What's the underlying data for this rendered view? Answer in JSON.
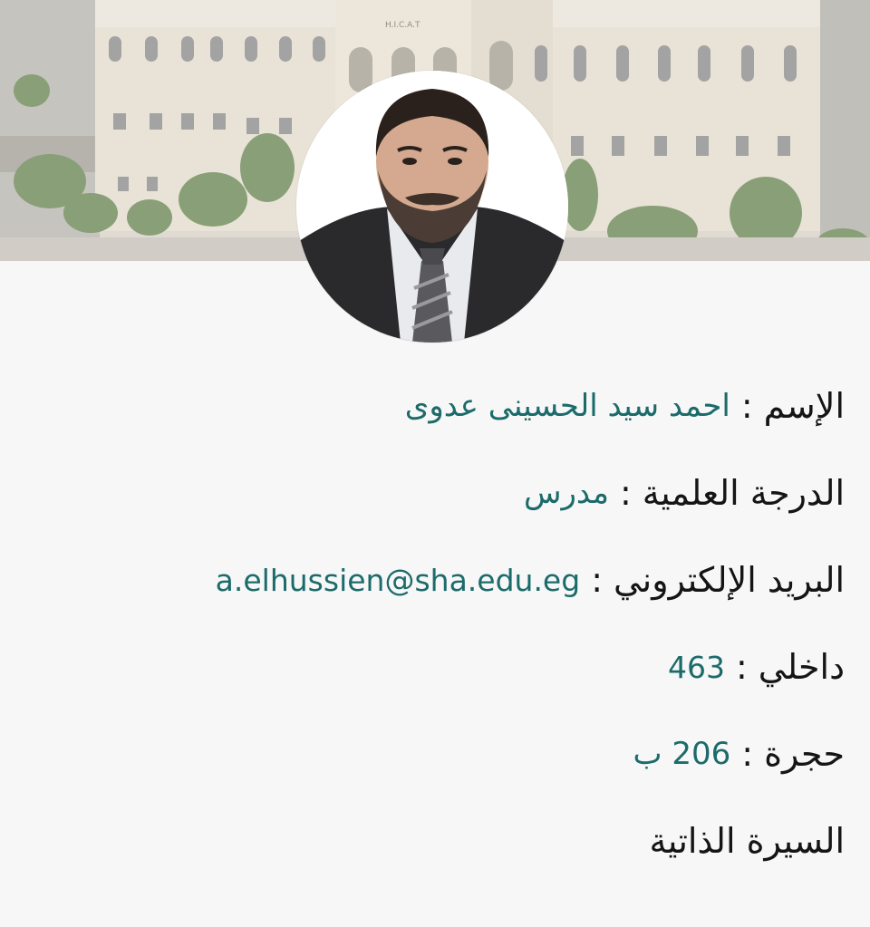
{
  "banner": {
    "building_sign": "H.I.C.A.T"
  },
  "profile": {
    "name_label": "الإسم",
    "name_value": "احمد سيد الحسينى عدوى",
    "degree_label": "الدرجة العلمية",
    "degree_value": "مدرس",
    "email_label": "البريد الإلكتروني",
    "email_value": "a.elhussien@sha.edu.eg",
    "extension_label": "داخلي",
    "extension_value": "463",
    "room_label": "حجرة",
    "room_value": "206 ب",
    "cv_link": "السيرة الذاتية",
    "separator": ":"
  },
  "colors": {
    "accent": "#1c6b6b",
    "text": "#151515",
    "background": "#f7f7f7"
  }
}
